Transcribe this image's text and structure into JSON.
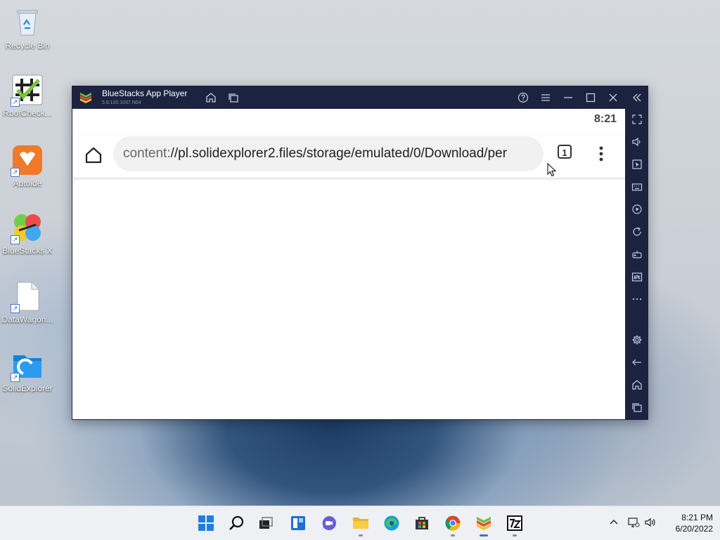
{
  "desktop": {
    "icons": [
      {
        "label": "Recycle Bin"
      },
      {
        "label": "RootCheck..."
      },
      {
        "label": "Aptoide"
      },
      {
        "label": "BlueStacks X"
      },
      {
        "label": "DataWagon..."
      },
      {
        "label": "SolidExplorer"
      }
    ]
  },
  "window": {
    "title": "BlueStacks App Player",
    "version": "5.8.100.1037  N64"
  },
  "android": {
    "status_time": "8:21",
    "url_scheme": "content:",
    "url_rest": "//pl.solidexplorer2.files/storage/emulated/0/Download/per",
    "tab_count": "1"
  },
  "taskbar": {
    "clock_time": "8:21 PM",
    "clock_date": "6/20/2022"
  },
  "colors": {
    "bs_frame": "#1b2340",
    "taskbar": "#eef0f3",
    "url_box": "#f1f1f1"
  }
}
